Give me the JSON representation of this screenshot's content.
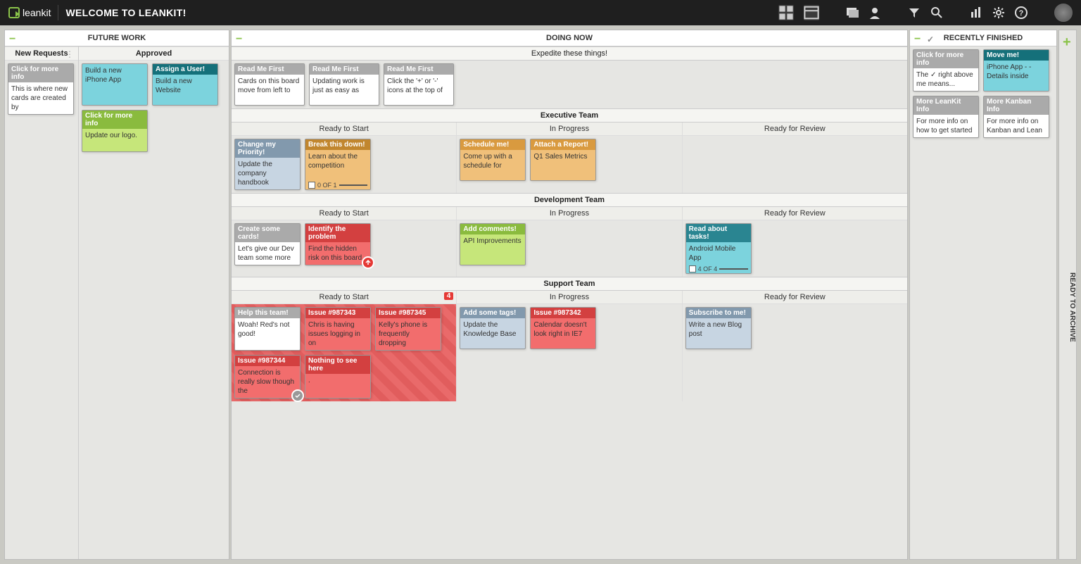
{
  "app": {
    "logo": "leankit",
    "title": "WELCOME TO LEANKIT!"
  },
  "columns": {
    "future": {
      "title": "FUTURE WORK",
      "newRequests": "New Requests",
      "approved": "Approved",
      "cards_new": [
        {
          "h": "Click for more info",
          "b": "This is where new cards are created by",
          "cls": "gray whitecard"
        }
      ],
      "cards_approved": [
        {
          "h": "",
          "b": "Build a new iPhone App",
          "cls": "teal"
        },
        {
          "h": "Assign a User!",
          "b": "Build a new Website",
          "cls": "tealdark"
        },
        {
          "h": "Click for more info",
          "b": "Update our logo.",
          "cls": "lime"
        }
      ]
    },
    "doing": {
      "title": "DOING NOW",
      "expedite": "Expedite these things!",
      "expedite_cards": [
        {
          "h": "Read Me First",
          "b": "Cards on this board move from left to",
          "cls": "gray whitecard"
        },
        {
          "h": "Read Me First",
          "b": "Updating work is just as easy as",
          "cls": "gray whitecard"
        },
        {
          "h": "Read Me First",
          "b": "Click the '+' or '-' icons at the top of",
          "cls": "gray whitecard"
        }
      ],
      "swimlanes": [
        {
          "name": "Executive Team",
          "cols": [
            "Ready to Start",
            "In Progress",
            "Ready for Review"
          ],
          "ready": [
            {
              "h": "Change my Priority!",
              "b": "Update the company handbook",
              "cls": "steel"
            },
            {
              "h": "Break this down!",
              "b": "Learn about the competition",
              "cls": "orange",
              "tasks": "0 OF 1"
            }
          ],
          "progress": [
            {
              "h": "Schedule me!",
              "b": "Come up with a schedule for",
              "cls": "orangelt"
            },
            {
              "h": "Attach a Report!",
              "b": "Q1 Sales Metrics",
              "cls": "orangelt"
            }
          ],
          "review": []
        },
        {
          "name": "Development Team",
          "cols": [
            "Ready to Start",
            "In Progress",
            "Ready for Review"
          ],
          "ready": [
            {
              "h": "Create some cards!",
              "b": "Let's give our Dev team some more",
              "cls": "gray whitecard"
            },
            {
              "h": "Identify the problem",
              "b": "Find the hidden risk on this board",
              "cls": "red",
              "alert": true
            }
          ],
          "progress": [
            {
              "h": "Add comments!",
              "b": "API Improvements",
              "cls": "lime"
            }
          ],
          "review": [
            {
              "h": "Read about tasks!",
              "b": "Android Mobile App",
              "cls": "teal",
              "tasks": "4 OF 4"
            }
          ]
        },
        {
          "name": "Support Team",
          "cols": [
            "Ready to Start",
            "In Progress",
            "Ready for Review"
          ],
          "readyBadge": "4",
          "readyRed": true,
          "ready": [
            {
              "h": "Help this team!",
              "b": "Woah! Red's not good!",
              "cls": "gray whitecard"
            },
            {
              "h": "Issue #987343",
              "b": "Chris is having issues logging in on",
              "cls": "red"
            },
            {
              "h": "Issue #987345",
              "b": "Kelly's phone is frequently dropping",
              "cls": "red"
            },
            {
              "h": "Issue #987344",
              "b": "Connection is really slow though the",
              "cls": "red",
              "grayalert": true
            },
            {
              "h": "Nothing to see here",
              "b": ".",
              "cls": "red"
            }
          ],
          "progress": [
            {
              "h": "Add some tags!",
              "b": "Update the Knowledge Base",
              "cls": "steel"
            },
            {
              "h": "Issue #987342",
              "b": "Calendar doesn't look right in IE7",
              "cls": "red"
            }
          ],
          "review": [
            {
              "h": "Subscribe to me!",
              "b": "Write a new Blog post",
              "cls": "steel"
            }
          ]
        }
      ]
    },
    "finished": {
      "title": "RECENTLY FINISHED",
      "cards": [
        {
          "h": "Click for more info",
          "b": "The ✓ right above me means...",
          "cls": "gray whitecard"
        },
        {
          "h": "Move me!",
          "b": "iPhone App - - Details inside",
          "cls": "tealdark"
        },
        {
          "h": "More LeanKit Info",
          "b": "For more info on how to get started",
          "cls": "gray whitecard"
        },
        {
          "h": "More Kanban Info",
          "b": "For more info on Kanban and Lean",
          "cls": "gray whitecard"
        }
      ]
    },
    "archive": "READY TO ARCHIVE"
  }
}
